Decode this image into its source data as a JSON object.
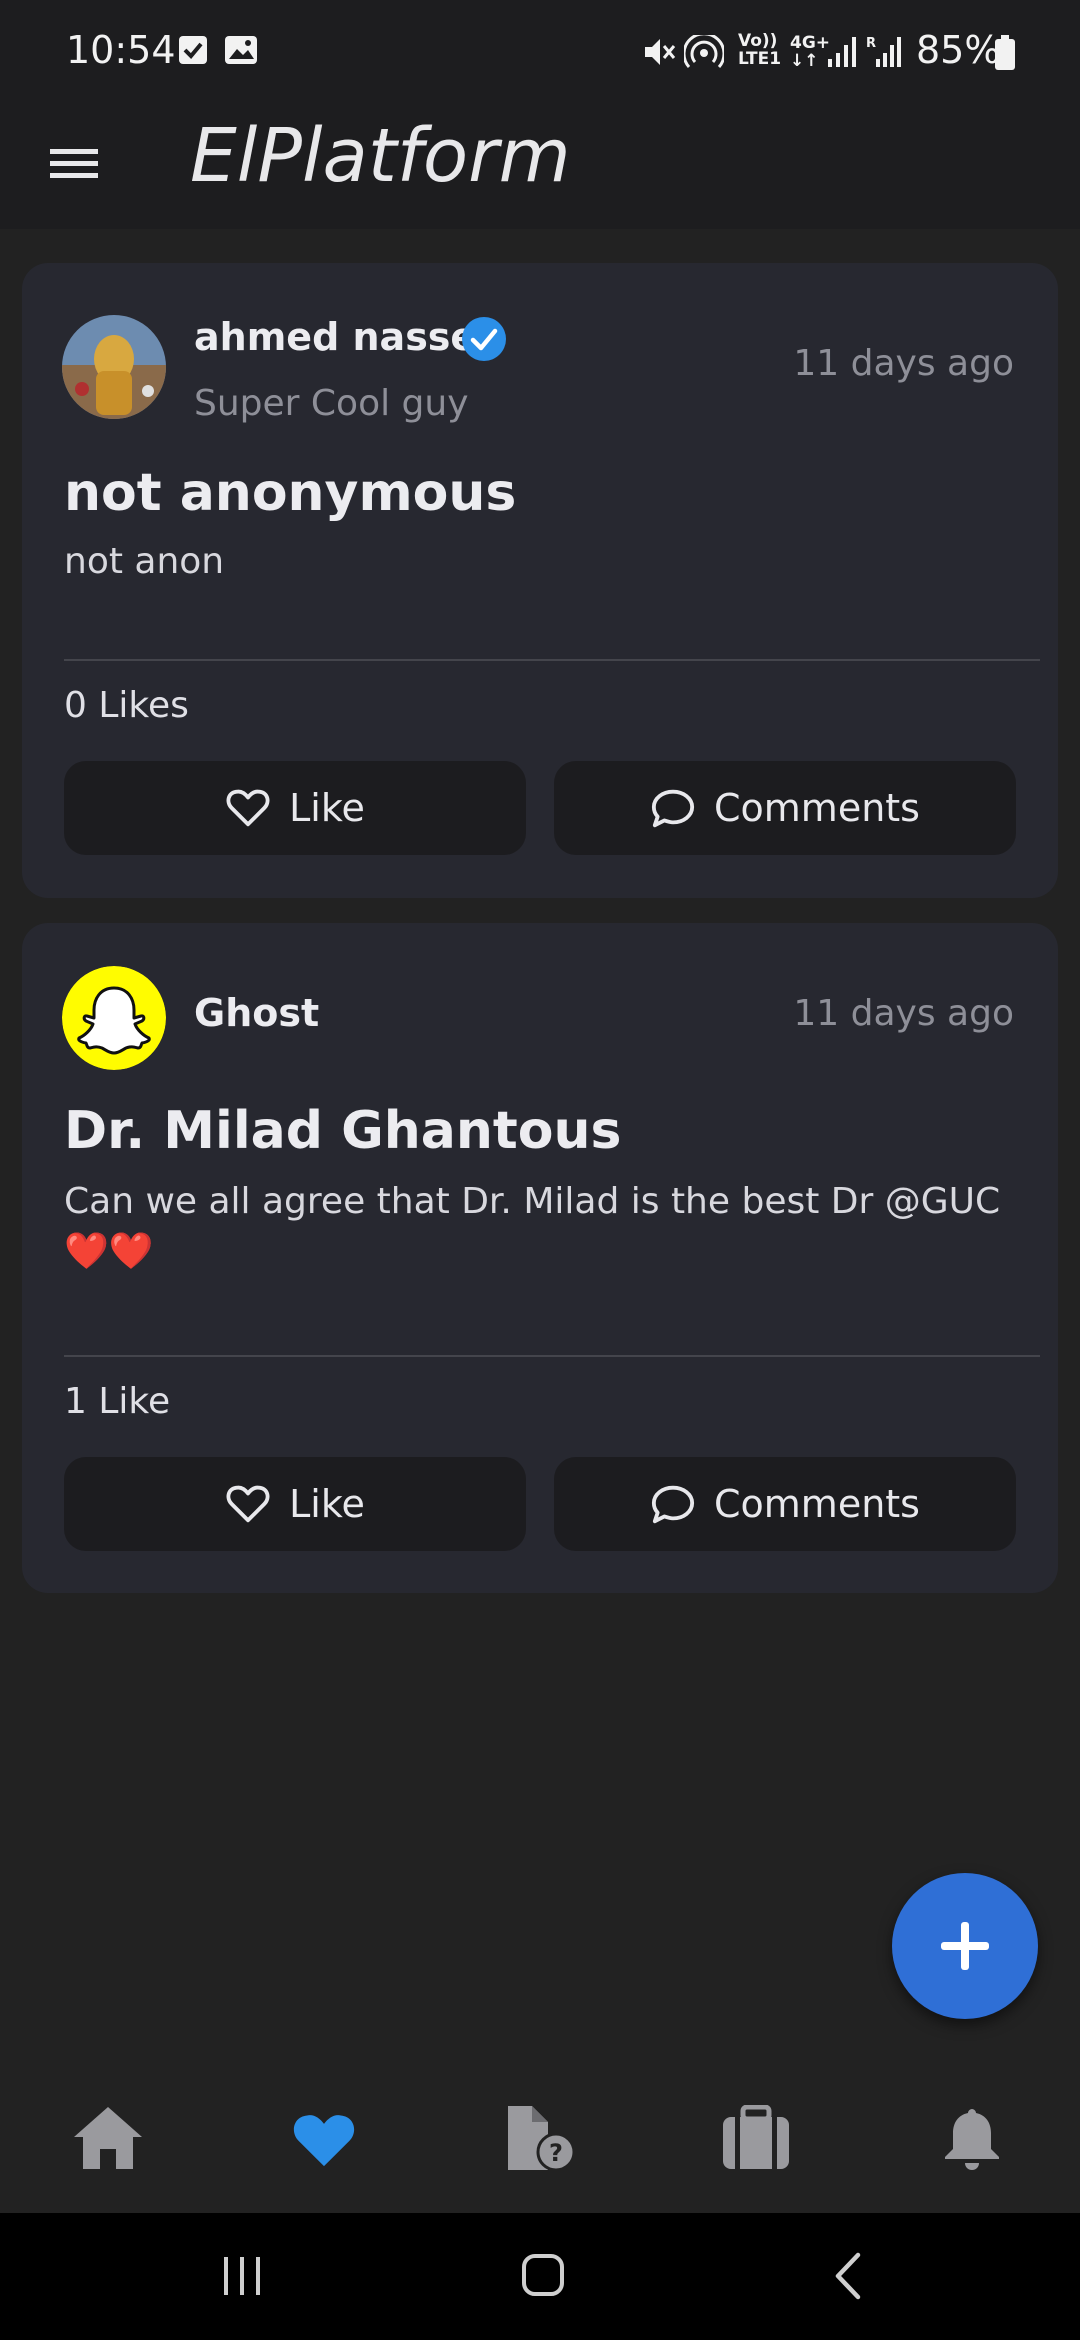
{
  "status_bar": {
    "time": "10:54",
    "battery": "85%",
    "icons": [
      "checkbox-notification-icon",
      "image-notification-icon",
      "mute-icon",
      "hotspot-icon",
      "volte-icon",
      "4g-icon",
      "signal-icon",
      "signal-roaming-icon",
      "battery-icon"
    ]
  },
  "app_bar": {
    "title": "ElPlatform",
    "menu_icon": "hamburger-menu-icon"
  },
  "posts": [
    {
      "author": "ahmed nasser",
      "verified": true,
      "author_subtitle": "Super Cool guy",
      "time": "11 days ago",
      "title": "not anonymous",
      "body": "not anon",
      "likes_label": "0 Likes",
      "like_label": "Like",
      "comments_label": "Comments"
    },
    {
      "author": "Ghost",
      "verified": false,
      "time": "11 days ago",
      "title": "Dr. Milad Ghantous",
      "body": "Can we all agree that Dr. Milad is the best Dr @GUC ❤️❤️",
      "likes_label": "1 Like",
      "like_label": "Like",
      "comments_label": "Comments"
    }
  ],
  "fab": {
    "icon": "plus-icon"
  },
  "bottom_nav": {
    "items": [
      {
        "icon": "home-icon",
        "active": false
      },
      {
        "icon": "heart-icon",
        "active": true
      },
      {
        "icon": "document-question-icon",
        "active": false
      },
      {
        "icon": "briefcase-icon",
        "active": false
      },
      {
        "icon": "bell-icon",
        "active": false
      }
    ]
  },
  "colors": {
    "background": "#222222",
    "card": "#272830",
    "button": "#1c1c1f",
    "accent": "#2f6fd6",
    "active_nav": "#2b8fe8",
    "inactive_nav": "#9a9a9e",
    "verified": "#2b8fe8",
    "snapchat_yellow": "#fffc00"
  }
}
